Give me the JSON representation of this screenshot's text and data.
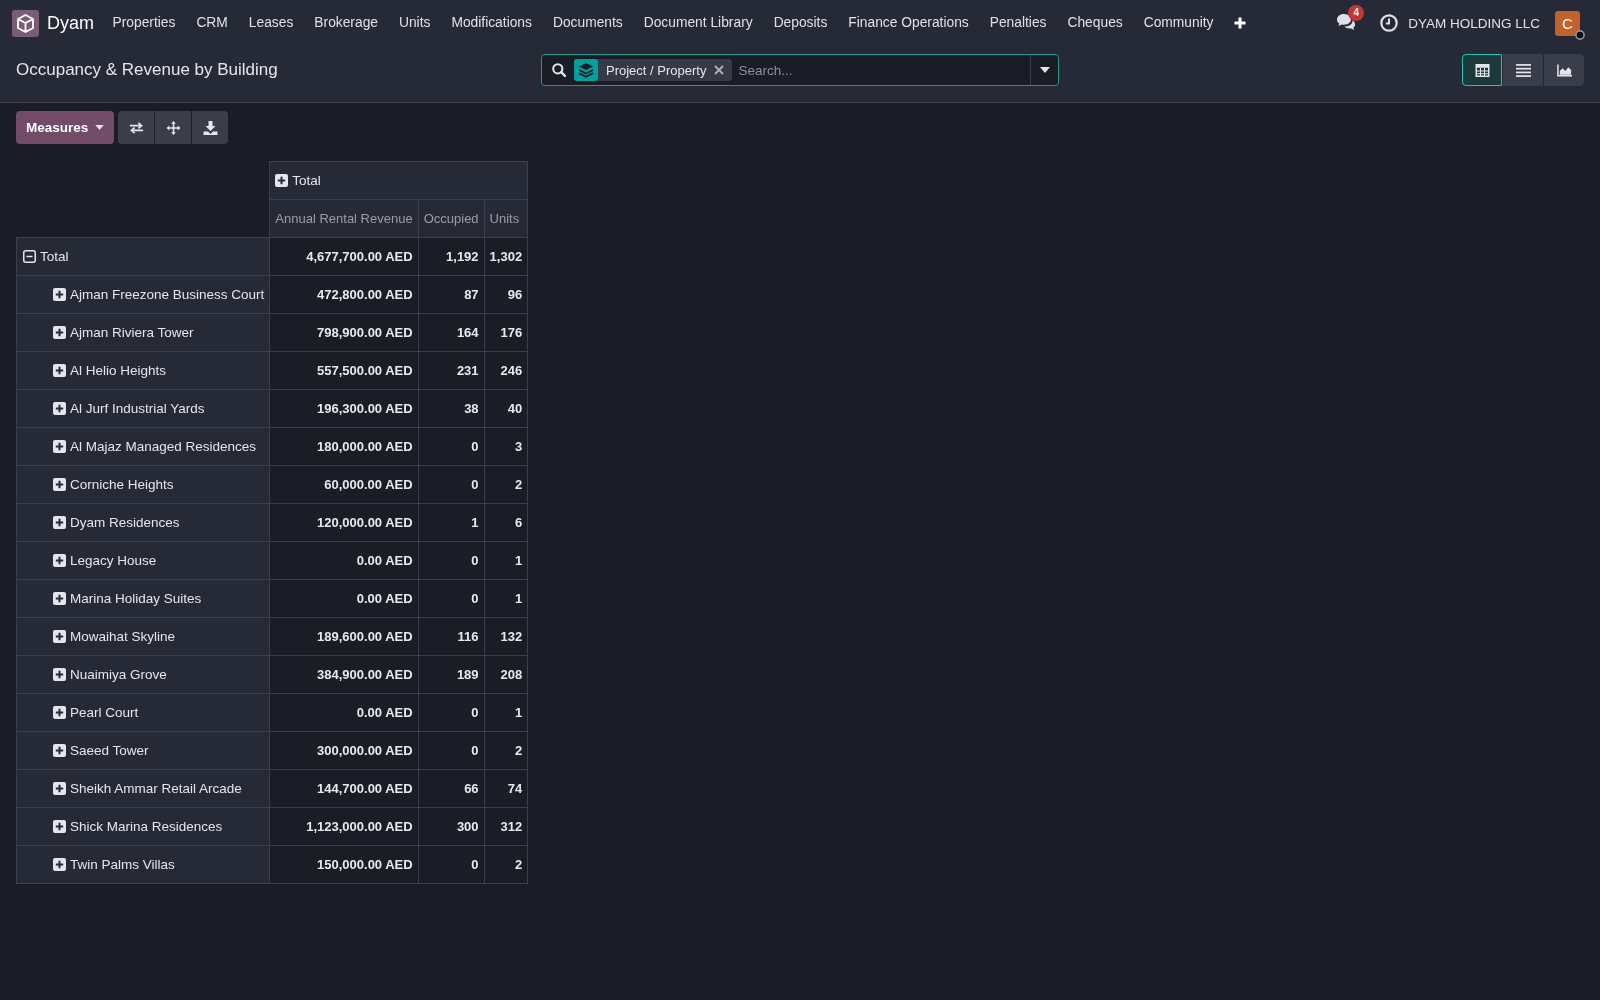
{
  "navbar": {
    "app_name": "Dyam",
    "menu": [
      "Properties",
      "CRM",
      "Leases",
      "Brokerage",
      "Units",
      "Modifications",
      "Documents",
      "Document Library",
      "Deposits",
      "Finance Operations",
      "Penalties",
      "Cheques",
      "Community"
    ],
    "notification_count": "4",
    "company": "DYAM HOLDING LLC",
    "avatar_initial": "C"
  },
  "control_panel": {
    "title": "Occupancy & Revenue by Building",
    "search": {
      "facets": [
        {
          "label": "Project / Property"
        }
      ],
      "placeholder": "Search..."
    },
    "views": [
      {
        "kind": "pivot",
        "selected": true
      },
      {
        "kind": "list",
        "selected": false
      },
      {
        "kind": "graph",
        "selected": false
      }
    ]
  },
  "toolbar": {
    "measures_button": "Measures"
  },
  "pivot": {
    "column_header": {
      "label": "Total",
      "expanded": false
    },
    "measures": [
      "Annual Rental Revenue",
      "Occupied",
      "Units"
    ],
    "rows": [
      {
        "label": "Total",
        "expanded": true,
        "values": [
          "4,677,700.00 AED",
          "1,192",
          "1,302"
        ],
        "children": [
          {
            "label": "Ajman Freezone Business Court",
            "expanded": false,
            "values": [
              "472,800.00 AED",
              "87",
              "96"
            ]
          },
          {
            "label": "Ajman Riviera Tower",
            "expanded": false,
            "values": [
              "798,900.00 AED",
              "164",
              "176"
            ]
          },
          {
            "label": "Al Helio Heights",
            "expanded": false,
            "values": [
              "557,500.00 AED",
              "231",
              "246"
            ]
          },
          {
            "label": "Al Jurf Industrial Yards",
            "expanded": false,
            "values": [
              "196,300.00 AED",
              "38",
              "40"
            ]
          },
          {
            "label": "Al Majaz Managed Residences",
            "expanded": false,
            "values": [
              "180,000.00 AED",
              "0",
              "3"
            ]
          },
          {
            "label": "Corniche Heights",
            "expanded": false,
            "values": [
              "60,000.00 AED",
              "0",
              "2"
            ]
          },
          {
            "label": "Dyam Residences",
            "expanded": false,
            "values": [
              "120,000.00 AED",
              "1",
              "6"
            ]
          },
          {
            "label": "Legacy House",
            "expanded": false,
            "values": [
              "0.00 AED",
              "0",
              "1"
            ]
          },
          {
            "label": "Marina Holiday Suites",
            "expanded": false,
            "values": [
              "0.00 AED",
              "0",
              "1"
            ]
          },
          {
            "label": "Mowaihat Skyline",
            "expanded": false,
            "values": [
              "189,600.00 AED",
              "116",
              "132"
            ]
          },
          {
            "label": "Nuaimiya Grove",
            "expanded": false,
            "values": [
              "384,900.00 AED",
              "189",
              "208"
            ]
          },
          {
            "label": "Pearl Court",
            "expanded": false,
            "values": [
              "0.00 AED",
              "0",
              "1"
            ]
          },
          {
            "label": "Saeed Tower",
            "expanded": false,
            "values": [
              "300,000.00 AED",
              "0",
              "2"
            ]
          },
          {
            "label": "Sheikh Ammar Retail Arcade",
            "expanded": false,
            "values": [
              "144,700.00 AED",
              "66",
              "74"
            ]
          },
          {
            "label": "Shick Marina Residences",
            "expanded": false,
            "values": [
              "1,123,000.00 AED",
              "300",
              "312"
            ]
          },
          {
            "label": "Twin Palms Villas",
            "expanded": false,
            "values": [
              "150,000.00 AED",
              "0",
              "2"
            ]
          }
        ]
      }
    ]
  }
}
